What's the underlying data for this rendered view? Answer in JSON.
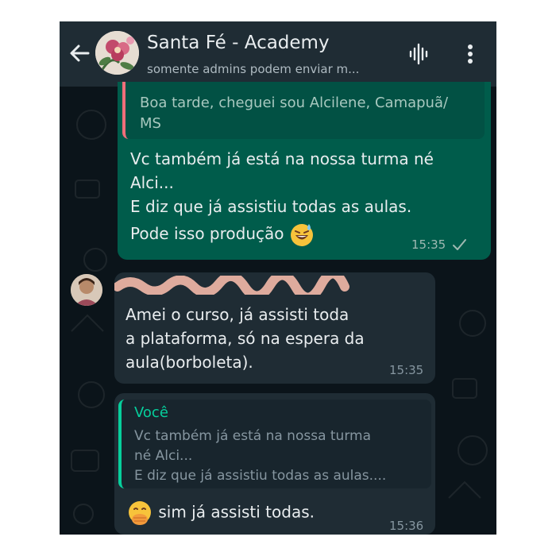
{
  "header": {
    "title": "Santa Fé - Academy",
    "subtitle": "somente admins podem enviar m..."
  },
  "messages": {
    "out1": {
      "quote_text": [
        "Boa tarde, cheguei sou Alcilene, Camapuã/",
        "MS"
      ],
      "lines": [
        "Vc também já está na nossa turma né",
        "Alci...",
        "E diz que já assistiu todas as aulas.",
        "Pode isso produção"
      ],
      "emoji": "sweat-smile-emoji",
      "time": "15:35",
      "status_icon": "single-check-icon"
    },
    "in1": {
      "lines": [
        "Amei o curso, já assisti toda",
        "a plataforma, só na espera da",
        "aula(borboleta)."
      ],
      "time": "15:35"
    },
    "in2": {
      "quote_author": "Você",
      "quote_lines": [
        "Vc também já está na nossa turma",
        "né Alci...",
        "E diz que já assistiu todas as aulas...."
      ],
      "emoji": "hand-over-mouth-emoji",
      "text": "sim já assisti todas.",
      "time": "15:36"
    }
  },
  "colors": {
    "header_bg": "#1f2c34",
    "chat_bg": "#0b141a",
    "outgoing_bubble": "#005c4b",
    "incoming_bubble": "#1f2c34",
    "accent": "#06cf9c"
  }
}
